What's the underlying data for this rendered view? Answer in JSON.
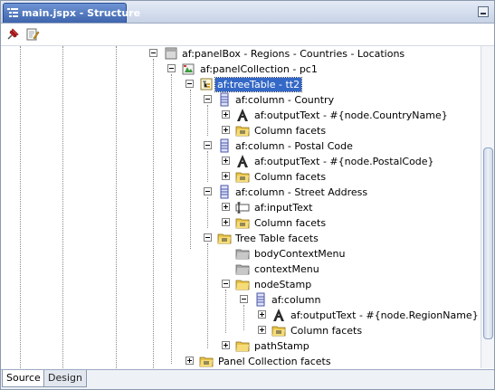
{
  "window": {
    "tab_title": "main.jspx - Structure"
  },
  "tree": {
    "nodes": [
      {
        "label": "af:panelBox - Regions - Countries - Locations",
        "icon": "panelbox-icon"
      },
      {
        "label": "af:panelCollection - pc1",
        "icon": "panelcollection-icon"
      },
      {
        "label": "af:treeTable - tt2",
        "icon": "treetable-icon",
        "selected": true
      },
      {
        "label": "af:column - Country",
        "icon": "column-icon"
      },
      {
        "label": "af:outputText - #{node.CountryName}",
        "icon": "outputtext-icon"
      },
      {
        "label": "Column facets",
        "icon": "folder-icon"
      },
      {
        "label": "af:column - Postal Code",
        "icon": "column-icon"
      },
      {
        "label": "af:outputText - #{node.PostalCode}",
        "icon": "outputtext-icon"
      },
      {
        "label": "Column facets",
        "icon": "folder-icon"
      },
      {
        "label": "af:column - Street Address",
        "icon": "column-icon"
      },
      {
        "label": "af:inputText",
        "icon": "inputtext-icon"
      },
      {
        "label": "Column facets",
        "icon": "folder-icon"
      },
      {
        "label": "Tree Table facets",
        "icon": "folder-icon"
      },
      {
        "label": "bodyContextMenu",
        "icon": "facet-folder-icon"
      },
      {
        "label": "contextMenu",
        "icon": "facet-folder-icon"
      },
      {
        "label": "nodeStamp",
        "icon": "folder-icon"
      },
      {
        "label": "af:column",
        "icon": "column-icon"
      },
      {
        "label": "af:outputText - #{node.RegionName}",
        "icon": "outputtext-icon"
      },
      {
        "label": "Column facets",
        "icon": "folder-icon"
      },
      {
        "label": "pathStamp",
        "icon": "folder-icon"
      },
      {
        "label": "Panel Collection facets",
        "icon": "folder-icon"
      }
    ]
  },
  "bottom_tabs": {
    "source": "Source",
    "design": "Design"
  }
}
